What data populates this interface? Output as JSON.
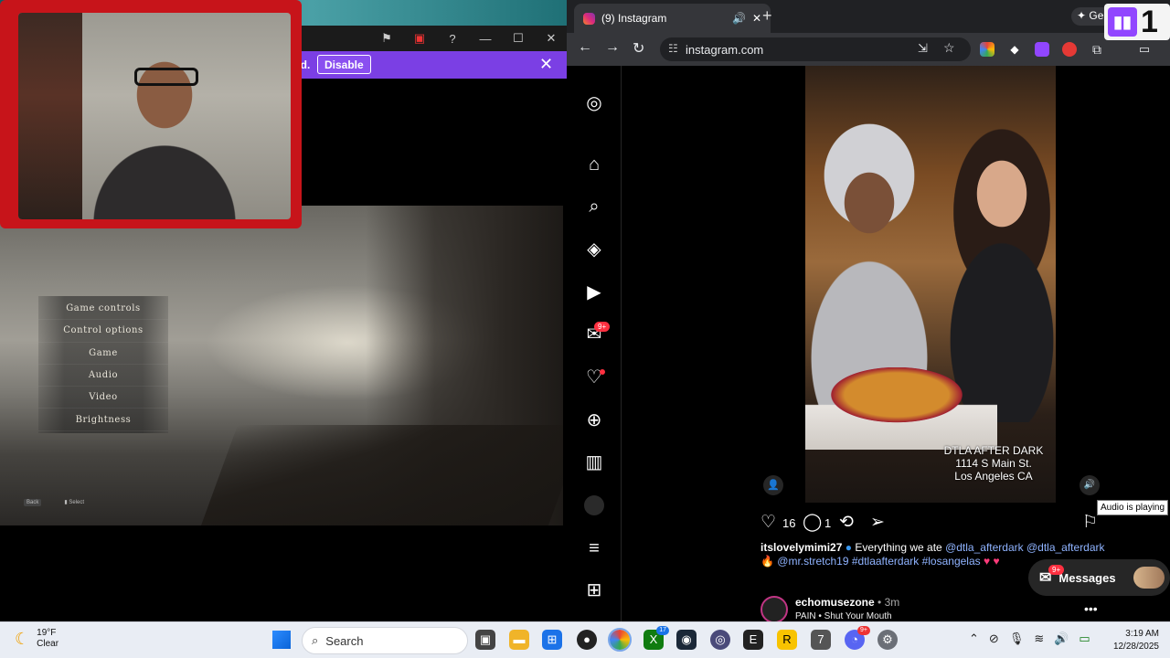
{
  "game_window": {
    "banner": {
      "text_fragment": "ed.",
      "disable_label": "Disable"
    },
    "menu_items": [
      "Game controls",
      "Control options",
      "Game",
      "Audio",
      "Video",
      "Brightness"
    ],
    "hints": {
      "back_key": "Back",
      "select_label": "Select"
    }
  },
  "browser": {
    "tab_title": "(9) Instagram",
    "url": "instagram.com",
    "gemini_label": "Gem",
    "extension_colors": [
      "#ea4335",
      "#ffffff",
      "#9146ff",
      "#e53935"
    ]
  },
  "instagram": {
    "nav_badge_messages": "9+",
    "video": {
      "caption": "DTLA AFTER DARK\n1114 S Main St.\nLos Angeles CA",
      "tooltip": "Audio is playing"
    },
    "actions": {
      "likes": "16",
      "comments": "1"
    },
    "post_caption": {
      "username": "itslovelymimi27",
      "text": "Everything we ate",
      "mention1": "@dtla_afterdark",
      "mention2": "@dtla_afterdark",
      "line2_mention": "@mr.stretch19",
      "tag1": "#dtlaafterdark",
      "tag2": "#losangelas"
    },
    "next_post": {
      "username": "echomusezone",
      "time": "• 3m",
      "audio": "PAIN • Shut Your Mouth"
    },
    "messages": {
      "label": "Messages",
      "badge": "9+"
    }
  },
  "twitch_overlay": {
    "count": "1"
  },
  "taskbar": {
    "weather": {
      "temp": "19°F",
      "condition": "Clear"
    },
    "search_placeholder": "Search",
    "xbox_badge": "17",
    "discord_badge": "9+",
    "clock": {
      "time": "3:19 AM",
      "date": "12/28/2025"
    }
  }
}
